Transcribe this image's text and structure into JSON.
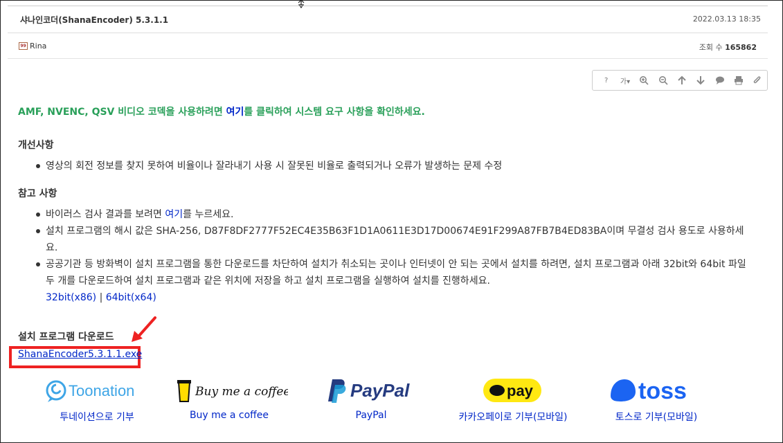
{
  "post": {
    "title": "샤나인코더(ShanaEncoder) 5.3.1.1",
    "date": "2022.03.13 18:35",
    "author": "Rina",
    "author_badge": "99",
    "views_label": "조회 수",
    "views": "165862"
  },
  "toolbar": {
    "help": "?",
    "font_size": "가",
    "items": [
      "help-icon",
      "font-size-icon",
      "zoom-in-icon",
      "zoom-out-icon",
      "arrow-up-icon",
      "arrow-down-icon",
      "comment-icon",
      "print-icon",
      "attach-icon"
    ]
  },
  "notice": {
    "before": "AMF, NVENC, QSV 비디오 코덱을 사용하려면 ",
    "link": "여기",
    "after": "를 클릭하여 시스템 요구 사항을 확인하세요."
  },
  "improvements": {
    "heading": "개선사항",
    "items": [
      "영상의 회전 정보를 찾지 못하여 비율이나 잘라내기 사용 시 잘못된 비율로 출력되거나 오류가 발생하는 문제 수정"
    ]
  },
  "notes": {
    "heading": "참고 사항",
    "virus_before": "바이러스 검사 결과를 보려면 ",
    "virus_link": "여기",
    "virus_after": "를 누르세요.",
    "hash": "설치 프로그램의 해시 값은 SHA-256, D87F8DF2777F52EC4E35B63F1D1A0611E3D17D00674E91F299A87FB7B4ED83BA이며 무결성 검사 용도로 사용하세요.",
    "firewall": "공공기관 등 방화벽이 설치 프로그램을 통한 다운로드를 차단하여 설치가 취소되는 곳이나 인터넷이 안 되는 곳에서 설치를 하려면, 설치 프로그램과 아래 32bit와 64bit 파일 두 개를 다운로드하여 설치 프로그램과 같은 위치에 저장을 하고 설치 프로그램을 실행하여 설치를 진행하세요.",
    "link_32": "32bit(x86)",
    "separator": "|",
    "link_64": "64bit(x64)"
  },
  "download": {
    "heading": "설치 프로그램 다운로드",
    "file": "ShanaEncoder5.3.1.1.exe"
  },
  "donations": [
    {
      "logo": "Toonation",
      "label": "투네이션으로 기부",
      "color": "#3ea5e6"
    },
    {
      "logo": "Buy me a coffee",
      "label": "Buy me a coffee",
      "color": "#111111"
    },
    {
      "logo": "PayPal",
      "label": "PayPal",
      "color": "#253b80"
    },
    {
      "logo": "pay",
      "label": "카카오페이로 기부(모바일)",
      "color": "#ffe812"
    },
    {
      "logo": "toss",
      "label": "토스로 기부(모바일)",
      "color": "#1b64f2"
    }
  ],
  "colors": {
    "accent_green": "#2aa05a",
    "link_blue": "#0026c8",
    "highlight_red": "#ee2222"
  }
}
